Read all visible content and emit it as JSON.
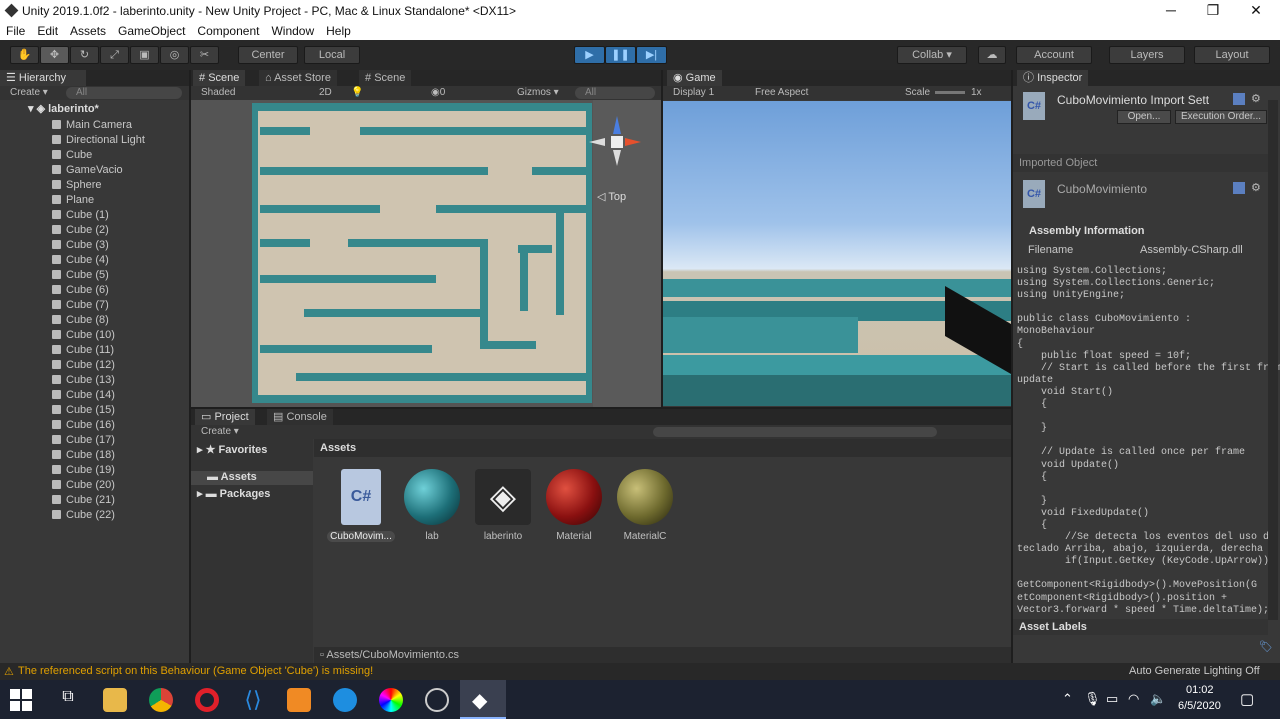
{
  "window": {
    "title": "Unity 2019.1.0f2 - laberinto.unity - New Unity Project - PC, Mac & Linux Standalone* <DX11>",
    "minimize": "─",
    "restore": "❐",
    "close": "✕"
  },
  "menu": [
    "File",
    "Edit",
    "Assets",
    "GameObject",
    "Component",
    "Window",
    "Help"
  ],
  "toolbar": {
    "tools": [
      "hand-icon",
      "move-icon",
      "rotate-icon",
      "scale-icon",
      "rect-icon",
      "transform-icon",
      "custom-tool-icon"
    ],
    "pivot": "Center",
    "space": "Local",
    "play": "▶",
    "pause": "❚❚",
    "step": "▶|",
    "collab": "Collab ▾",
    "account": "Account",
    "layers": "Layers",
    "layout": "Layout"
  },
  "hierarchy": {
    "tab": "Hierarchy",
    "create": "Create ▾",
    "search_placeholder": "All",
    "scene": "laberinto*",
    "items": [
      "Main Camera",
      "Directional Light",
      "Cube",
      "GameVacio",
      "Sphere",
      "Plane",
      "Cube (1)",
      "Cube (2)",
      "Cube (3)",
      "Cube (4)",
      "Cube (5)",
      "Cube (6)",
      "Cube (7)",
      "Cube (8)",
      "Cube (10)",
      "Cube (11)",
      "Cube (12)",
      "Cube (13)",
      "Cube (14)",
      "Cube (15)",
      "Cube (16)",
      "Cube (17)",
      "Cube (18)",
      "Cube (19)",
      "Cube (20)",
      "Cube (21)",
      "Cube (22)"
    ]
  },
  "scene": {
    "tabs": [
      "Scene",
      "Asset Store",
      "Scene"
    ],
    "shading": "Shaded",
    "mode2d": "2D",
    "gizmos": "Gizmos ▾",
    "search_placeholder": "All",
    "fx_count": "0",
    "view_label": "Top"
  },
  "game": {
    "tab": "Game",
    "display": "Display 1",
    "aspect": "Free Aspect",
    "scale_label": "Scale",
    "scale_value": "1x"
  },
  "inspector": {
    "tab": "Inspector",
    "title": "CuboMovimiento Import Sett",
    "open": "Open...",
    "execution_order": "Execution Order...",
    "imported_object": "Imported Object",
    "object_name": "CuboMovimiento",
    "assembly_title": "Assembly Information",
    "filename_label": "Filename",
    "filename_value": "Assembly-CSharp.dll",
    "code": "using System.Collections;\nusing System.Collections.Generic;\nusing UnityEngine;\n\npublic class CuboMovimiento :\nMonoBehaviour\n{\n    public float speed = 10f;\n    // Start is called before the first frame\nupdate\n    void Start()\n    {\n\n    }\n\n    // Update is called once per frame\n    void Update()\n    {\n\n    }\n    void FixedUpdate()\n    {\n        //Se detecta los eventos del uso de\nteclado Arriba, abajo, izquierda, derecha\n        if(Input.GetKey (KeyCode.UpArrow)){\n\nGetComponent<Rigidbody>().MovePosition(G\netComponent<Rigidbody>().position +\nVector3.forward * speed * Time.deltaTime);",
    "asset_labels": "Asset Labels"
  },
  "project": {
    "tabs": [
      "Project",
      "Console"
    ],
    "create": "Create ▾",
    "favorites": "Favorites",
    "assets_folder": "Assets",
    "packages_folder": "Packages",
    "breadcrumb": "Assets",
    "assets": [
      {
        "name": "CuboMovim...",
        "kind": "cs"
      },
      {
        "name": "lab",
        "kind": "teal"
      },
      {
        "name": "laberinto",
        "kind": "unity"
      },
      {
        "name": "Material",
        "kind": "red"
      },
      {
        "name": "MaterialC",
        "kind": "olive"
      }
    ],
    "path": "Assets/CuboMovimiento.cs"
  },
  "status": {
    "warning": "The referenced script on this Behaviour (Game Object 'Cube') is missing!",
    "lighting": "Auto Generate Lighting Off"
  },
  "taskbar": {
    "time": "01:02",
    "date": "6/5/2020"
  },
  "colors": {
    "accent": "#2f6ea8",
    "wall": "#36888c",
    "warning": "#e0a000"
  }
}
